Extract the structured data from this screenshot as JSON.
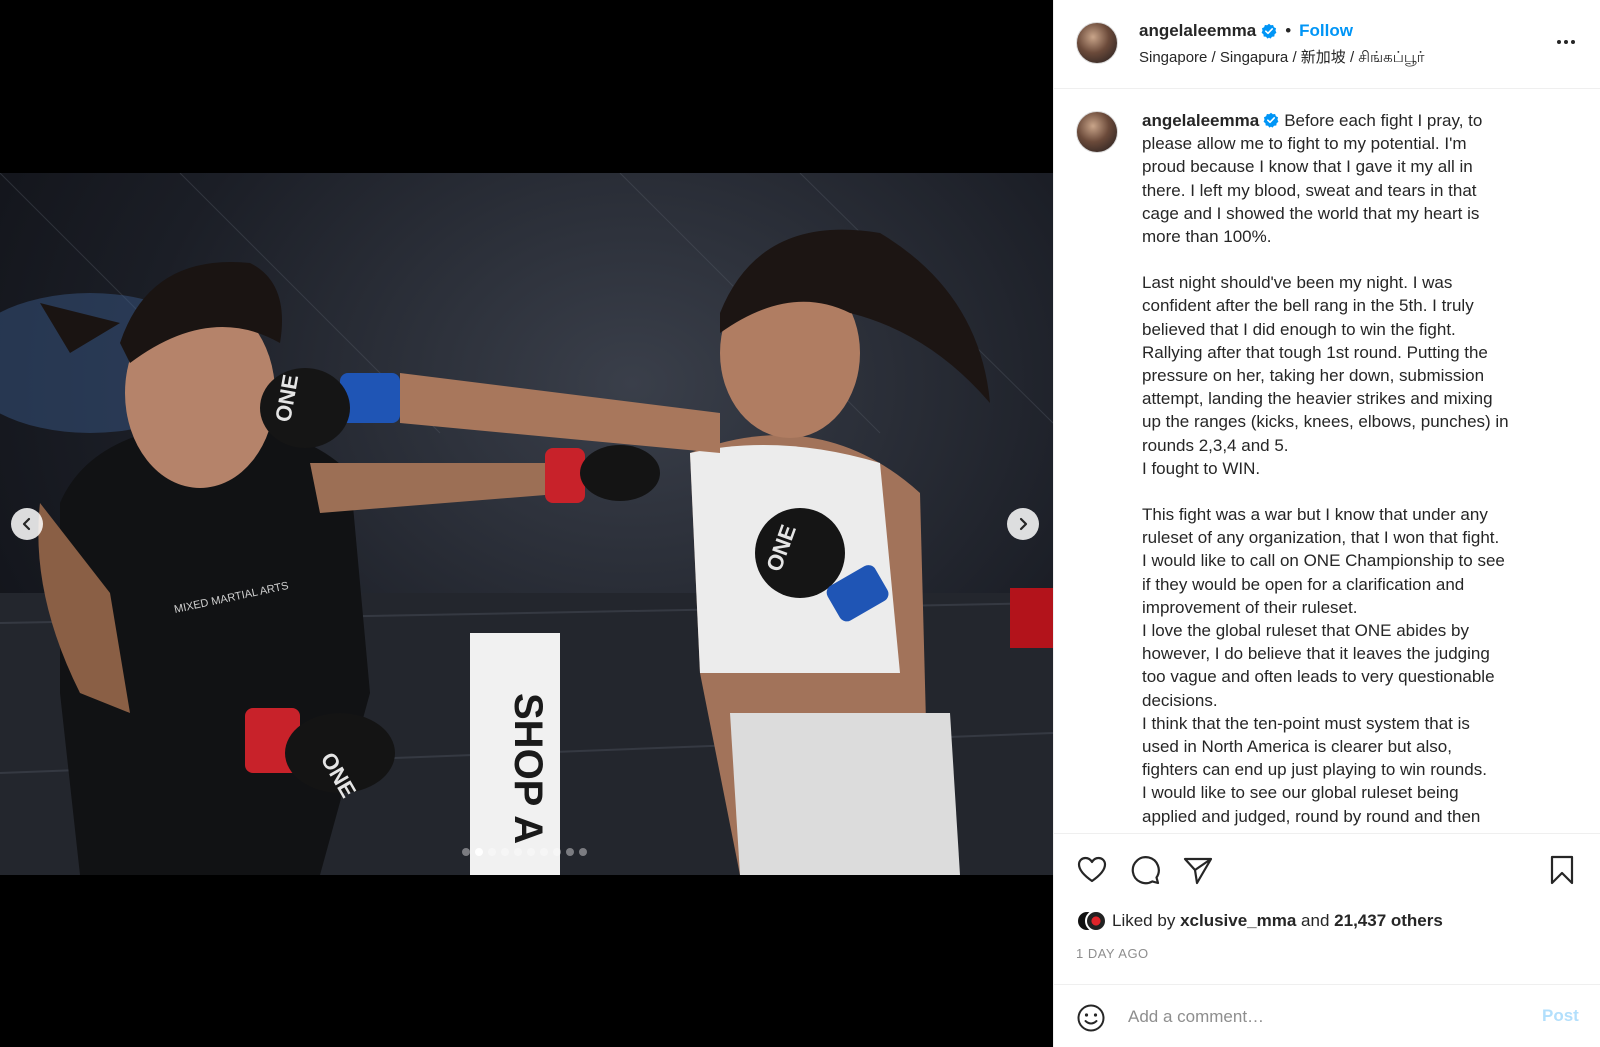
{
  "post": {
    "username": "angelaleemma",
    "verified": true,
    "follow_label": "Follow",
    "separator": "•",
    "location": "Singapore / Singapura / 新加坡 / சிங்கப்பூர்"
  },
  "media": {
    "carousel_count": 10,
    "active_index": 1,
    "photo_texts": {
      "glove_brand": "ONE",
      "shirt_logo": "MIXED MARTIAL ARTS",
      "banner": "SHOP A"
    }
  },
  "caption": {
    "username": "angelaleemma",
    "paragraphs": [
      [
        "Before each fight I pray, to",
        "please allow me to fight to my potential. I'm",
        "proud because I know that I gave it my all in",
        "there. I left my blood, sweat and tears in that",
        "cage and I showed the world that my heart is",
        "more than 100%."
      ],
      [
        "Last night should've been my night. I was",
        "confident after the bell rang in the 5th. I truly",
        "believed that I did enough to win the fight.",
        "Rallying after that tough 1st round. Putting the",
        "pressure on her, taking her down, submission",
        "attempt, landing the heavier strikes and mixing",
        "up the ranges (kicks, knees, elbows, punches) in",
        "rounds 2,3,4 and 5.",
        "I fought to WIN."
      ],
      [
        "This fight was a war but I know that under any",
        "ruleset of any organization, that I won that fight.",
        "I would like to call on ONE Championship to see",
        "if they would be open for a clarification and",
        "improvement of their ruleset.",
        "I love the global ruleset that ONE abides by",
        "however, I do believe that it leaves the judging",
        "too vague and often leads to very questionable",
        "decisions.",
        "I think that the ten-point must system that is",
        "used in North America is clearer but also,",
        "fighters can end up just playing to win rounds.",
        "I would like to see our global ruleset being",
        "applied and judged, round by round and then"
      ]
    ]
  },
  "likes": {
    "prefix": "Liked by",
    "liker": "xclusive_mma",
    "conjunction": "and",
    "others": "21,437 others"
  },
  "timestamp": "1 DAY AGO",
  "comment": {
    "placeholder": "Add a comment…",
    "post_label": "Post"
  },
  "colors": {
    "accent": "#0095f6",
    "post_disabled": "#b2dffc",
    "text": "#262626",
    "muted": "#8e8e8e"
  }
}
